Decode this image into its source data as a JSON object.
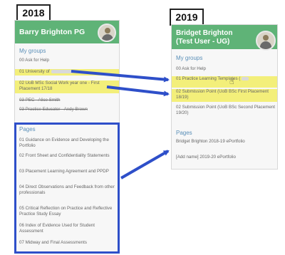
{
  "labels": {
    "left_year": "2018",
    "right_year": "2019"
  },
  "left_panel": {
    "user_name": "Barry Brighton PG",
    "groups_title": "My groups",
    "groups": [
      {
        "label": "00 Ask for Help",
        "highlight": false,
        "struck": false
      },
      {
        "label": "01 University of",
        "highlight": true,
        "struck": false
      },
      {
        "label": "02 UoB MSc Social Work year one - First Placement 17/18",
        "highlight": true,
        "struck": false
      },
      {
        "label": "03 PEC - Alice Smith",
        "highlight": false,
        "struck": true
      },
      {
        "label": "03 Practice Educator - Andy Brown",
        "highlight": false,
        "struck": true
      }
    ],
    "pages_title": "Pages",
    "pages": [
      "01 Guidance on Evidence and Developing the Portfolio",
      "02 Front Sheet and Confidentiality Statements",
      "03 Placement Learning Agreement and PPDP",
      "04 Direct Observations and Feedback from other professionals",
      "05 Critical Reflection on Practice and Reflective Practice Study Essay",
      "06 Index of Evidence Used for Student Assessment",
      "07 Midway and Final Assessments"
    ]
  },
  "right_panel": {
    "user_name": "Bridget Brighton (Test User - UG)",
    "groups_title": "My groups",
    "groups": [
      {
        "label": "00 Ask for Help",
        "highlight": false
      },
      {
        "label": "01 Practice Learning Templates (",
        "highlight": true
      },
      {
        "label": "02 Submission Point (UoB BSc First Placement 18/19)",
        "highlight": true
      },
      {
        "label": "02 Submission Point (UoB BSc Second Placement 19/20)",
        "highlight": false
      }
    ],
    "pages_title": "Pages",
    "pages": [
      "Bridget Brighton 2018-19 ePortfolio",
      "[Add name] 2019-20 ePortfolio"
    ]
  },
  "colors": {
    "header_green": "#5fb377",
    "highlight_yellow": "#f3ef7a",
    "arrow_blue": "#2e4fc9",
    "section_blue": "#5a8fb8"
  }
}
